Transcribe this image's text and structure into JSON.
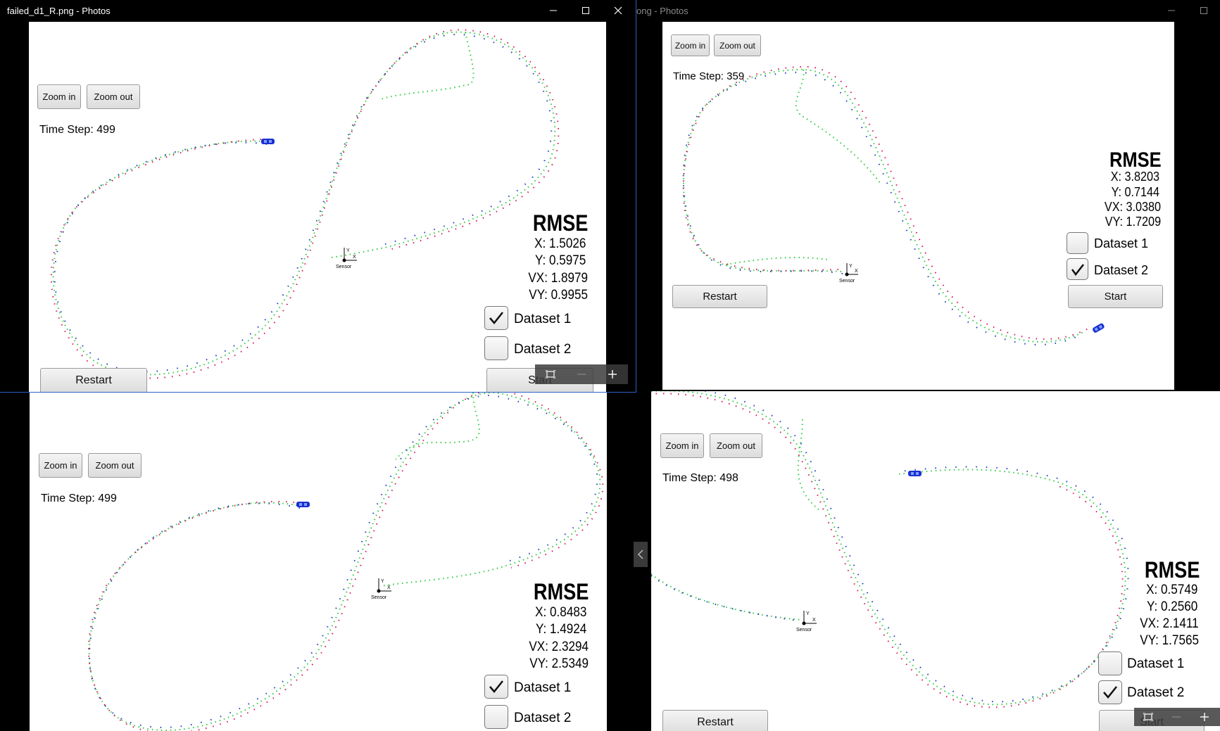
{
  "windows": {
    "tl": {
      "title": "failed_d1_R.png - Photos"
    },
    "tr": {
      "title": "ong - Photos"
    }
  },
  "panels": {
    "tl": {
      "zoom_in": "Zoom in",
      "zoom_out": "Zoom out",
      "time_step": "Time Step: 499",
      "rmse_title": "RMSE",
      "x": "X: 1.5026",
      "y": "Y: 0.5975",
      "vx": "VX: 1.8979",
      "vy": "VY: 0.9955",
      "dataset1": "Dataset 1",
      "dataset2": "Dataset 2",
      "dataset1_checked": true,
      "dataset2_checked": false,
      "restart": "Restart",
      "start": "Start",
      "sensor": "Sensor"
    },
    "tr": {
      "zoom_in": "Zoom in",
      "zoom_out": "Zoom out",
      "time_step": "Time Step: 359",
      "rmse_title": "RMSE",
      "x": "X: 3.8203",
      "y": "Y: 0.7144",
      "vx": "VX: 3.0380",
      "vy": "VY: 1.7209",
      "dataset1": "Dataset 1",
      "dataset2": "Dataset 2",
      "dataset1_checked": false,
      "dataset2_checked": true,
      "restart": "Restart",
      "start": "Start",
      "sensor": "Sensor"
    },
    "bl": {
      "zoom_in": "Zoom in",
      "zoom_out": "Zoom out",
      "time_step": "Time Step: 499",
      "rmse_title": "RMSE",
      "x": "X: 0.8483",
      "y": "Y: 1.4924",
      "vx": "VX: 2.3294",
      "vy": "VY: 2.5349",
      "dataset1": "Dataset 1",
      "dataset2": "Dataset 2",
      "dataset1_checked": true,
      "dataset2_checked": false,
      "sensor": "Sensor"
    },
    "br": {
      "zoom_in": "Zoom in",
      "zoom_out": "Zoom out",
      "time_step": "Time Step: 498",
      "rmse_title": "RMSE",
      "x": "X: 0.5749",
      "y": "Y: 0.2560",
      "vx": "VX: 2.1411",
      "vy": "VY: 1.7565",
      "dataset1": "Dataset 1",
      "dataset2": "Dataset 2",
      "dataset1_checked": false,
      "dataset2_checked": true,
      "restart": "Restart",
      "start": "Start",
      "sensor": "Sensor"
    }
  },
  "colors": {
    "ground_truth": "#2ecc40",
    "lidar": "#e0115f",
    "radar": "#1f3fbf",
    "car": "#1a2fd0"
  },
  "icons": [
    "minimize-icon",
    "maximize-icon",
    "close-icon",
    "fit-screen-icon",
    "zoom-out-minus-icon",
    "zoom-in-plus-icon",
    "chevron-left-icon",
    "checkmark-icon",
    "sensor-axes-icon",
    "car-icon"
  ]
}
